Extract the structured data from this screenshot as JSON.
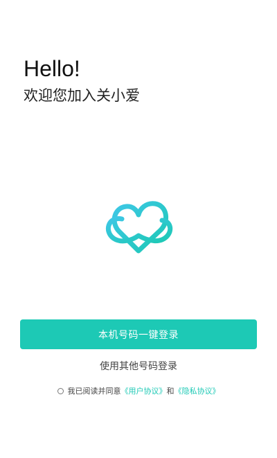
{
  "header": {
    "greeting": "Hello!",
    "welcome": "欢迎您加入关小爱"
  },
  "logo": {
    "icon": "heart-cloud-logo-icon",
    "gradient_start": "#3ec7e6",
    "gradient_end": "#1dc9b5"
  },
  "actions": {
    "one_click_login": "本机号码一键登录",
    "other_number_login": "使用其他号码登录"
  },
  "agreement": {
    "prefix": "我已阅读并同意",
    "user_agreement": "《用户协议》",
    "conjunction": "和",
    "privacy_policy": "《隐私协议》",
    "checked": false
  },
  "colors": {
    "accent": "#1dc9b5",
    "text": "#222222"
  }
}
